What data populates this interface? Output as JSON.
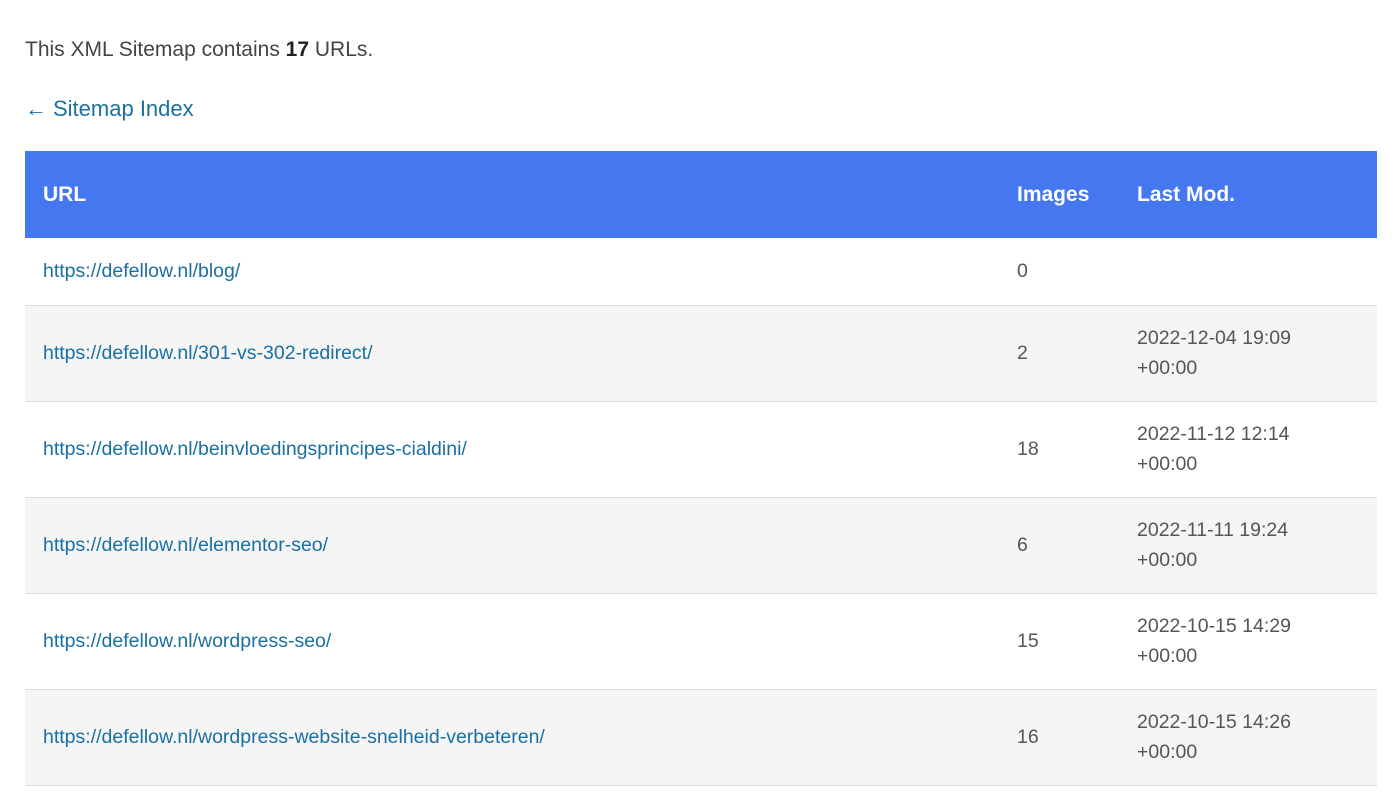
{
  "intro": {
    "prefix": "This XML Sitemap contains ",
    "count": "17",
    "suffix": " URLs."
  },
  "back_link": {
    "arrow": "←",
    "label": "Sitemap Index"
  },
  "table": {
    "headers": {
      "url": "URL",
      "images": "Images",
      "last_mod": "Last Mod."
    },
    "rows": [
      {
        "url": "https://defellow.nl/blog/",
        "images": "0",
        "last_mod": ""
      },
      {
        "url": "https://defellow.nl/301-vs-302-redirect/",
        "images": "2",
        "last_mod": "2022-12-04 19:09\n+00:00"
      },
      {
        "url": "https://defellow.nl/beinvloedingsprincipes-cialdini/",
        "images": "18",
        "last_mod": "2022-11-12 12:14\n+00:00"
      },
      {
        "url": "https://defellow.nl/elementor-seo/",
        "images": "6",
        "last_mod": "2022-11-11 19:24\n+00:00"
      },
      {
        "url": "https://defellow.nl/wordpress-seo/",
        "images": "15",
        "last_mod": "2022-10-15 14:29\n+00:00"
      },
      {
        "url": "https://defellow.nl/wordpress-website-snelheid-verbeteren/",
        "images": "16",
        "last_mod": "2022-10-15 14:26\n+00:00"
      }
    ]
  },
  "colors": {
    "header_bg": "#4477f0",
    "link": "#1a6fa3",
    "stripe": "#f5f5f5"
  }
}
